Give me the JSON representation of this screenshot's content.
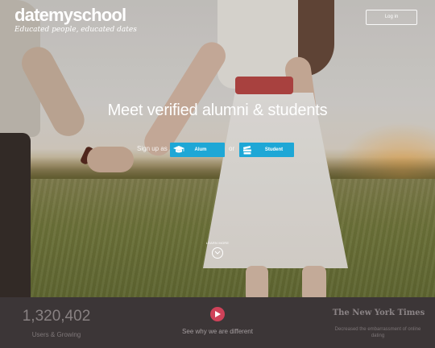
{
  "header": {
    "logo": "datemyschool",
    "tagline": "Educated people, educated dates",
    "login_label": "Log in"
  },
  "hero": {
    "headline": "Meet verified alumni & students",
    "signup_as": "Sign up as",
    "alum_label": "Alum",
    "or": "or",
    "student_label": "Student",
    "learn_more": "LEARN MORE"
  },
  "stats": {
    "count": "1,320,402",
    "count_label": "Users & Growing",
    "video_label": "See why we are different",
    "press_name": "The New York Times",
    "press_quote": "Decreased the embarrassment of online dating"
  },
  "colors": {
    "cta_blue": "#1ea7d6",
    "play_red": "#cf4259",
    "footer_bg": "#3c3637"
  },
  "icons": {
    "alum": "graduation-cap-icon",
    "student": "books-icon",
    "learn_more": "chevron-down-icon",
    "video": "play-icon"
  }
}
